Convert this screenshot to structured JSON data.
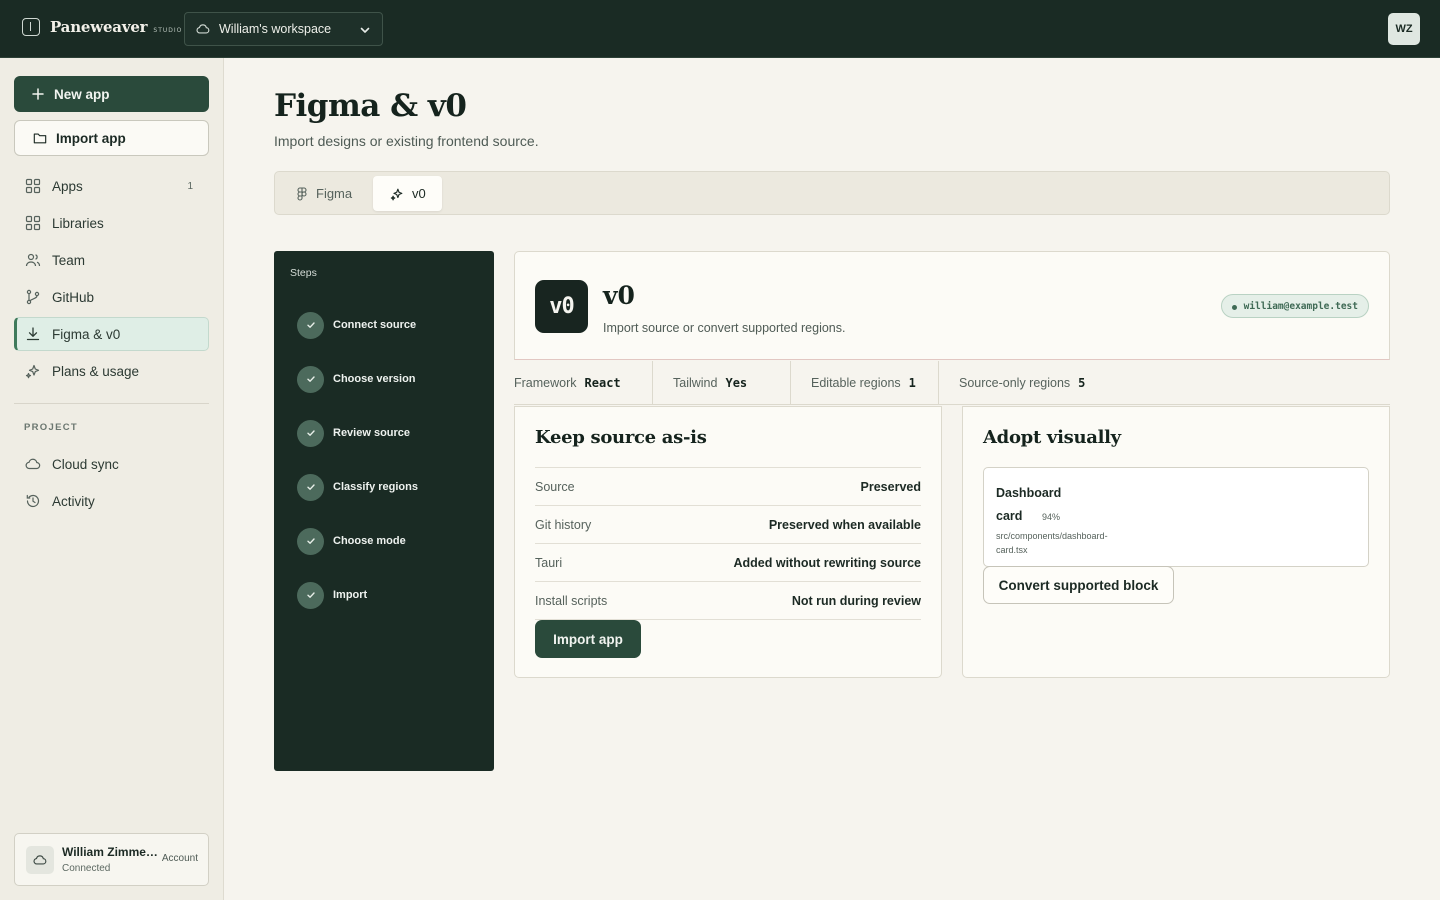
{
  "app": {
    "brand_name": "Paneweaver",
    "brand_sub": "STUDIO",
    "workspace": "William's workspace",
    "avatar_initials": "WZ"
  },
  "sidebar": {
    "new_app": "New app",
    "import_app": "Import app",
    "items": [
      {
        "label": "Apps",
        "count": "1",
        "icon": "grid-icon"
      },
      {
        "label": "Libraries",
        "icon": "grid-icon"
      },
      {
        "label": "Team",
        "icon": "users-icon"
      },
      {
        "label": "GitHub",
        "icon": "git-branch-icon"
      },
      {
        "label": "Figma & v0",
        "icon": "download-icon",
        "active": true
      },
      {
        "label": "Plans & usage",
        "icon": "sparkle-icon"
      }
    ],
    "section_label": "PROJECT",
    "project_items": [
      {
        "label": "Cloud sync",
        "icon": "cloud-icon"
      },
      {
        "label": "Activity",
        "icon": "history-icon"
      }
    ],
    "account": {
      "name": "William Zimmerman",
      "status": "Connected",
      "link": "Account"
    }
  },
  "main": {
    "title": "Figma & v0",
    "subtitle": "Import designs or existing frontend source.",
    "tabs": [
      {
        "label": "Figma",
        "active": false
      },
      {
        "label": "v0",
        "active": true
      }
    ]
  },
  "steps": {
    "title": "Steps",
    "items": [
      "Connect source",
      "Choose version",
      "Review source",
      "Classify regions",
      "Choose mode",
      "Import"
    ]
  },
  "source": {
    "logo_text": "v0",
    "name": "v0",
    "description": "Import source or convert supported regions.",
    "email": "william@example.test"
  },
  "stats": [
    {
      "label": "Framework",
      "value": "React"
    },
    {
      "label": "Tailwind",
      "value": "Yes"
    },
    {
      "label": "Editable regions",
      "value": "1"
    },
    {
      "label": "Source-only regions",
      "value": "5"
    }
  ],
  "keep": {
    "title": "Keep source as-is",
    "rows": [
      {
        "key": "Source",
        "value": "Preserved"
      },
      {
        "key": "Git history",
        "value": "Preserved when available"
      },
      {
        "key": "Tauri",
        "value": "Added without rewriting source"
      },
      {
        "key": "Install scripts",
        "value": "Not run during review"
      }
    ],
    "button": "Import app"
  },
  "adopt": {
    "title": "Adopt visually",
    "region_title_line1": "Dashboard",
    "region_title_line2": "card",
    "region_score": "94%",
    "region_path": "src/components/dashboard-card.tsx",
    "button": "Convert supported block"
  },
  "colors": {
    "topbar": "#1a2b24",
    "primary": "#2a4a3b",
    "active_nav": "#dfeee6",
    "page_bg": "#f6f4ee"
  }
}
